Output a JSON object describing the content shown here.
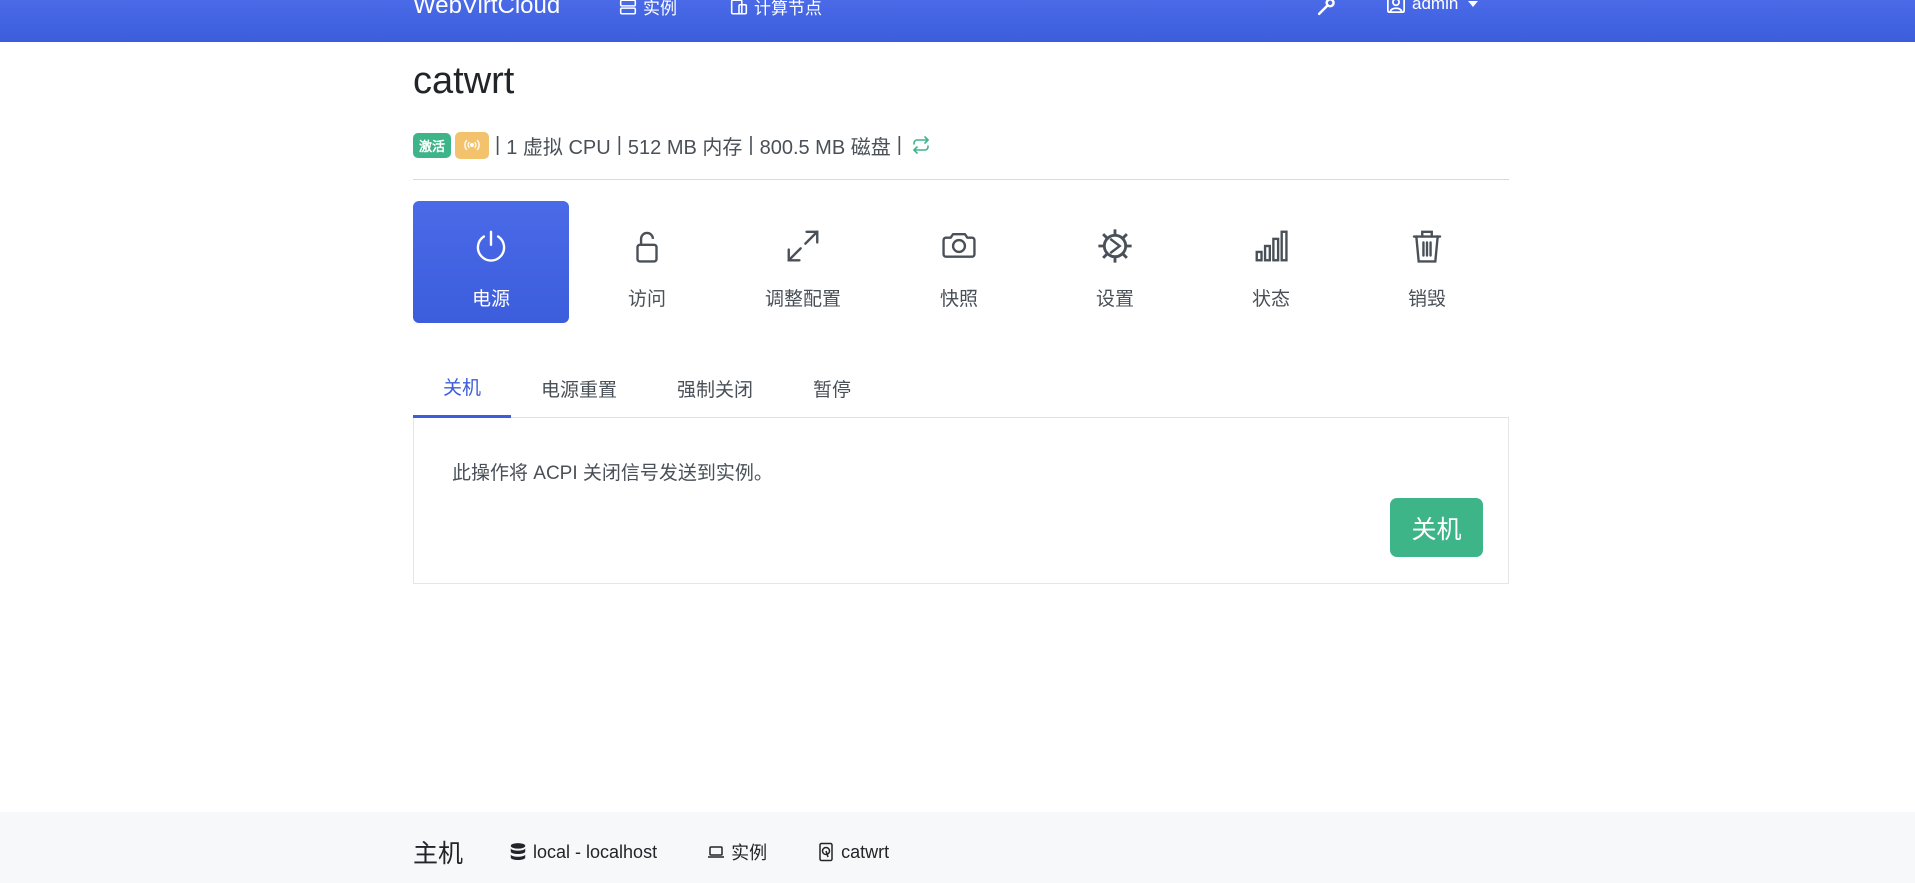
{
  "navbar": {
    "brand": "WebVirtCloud",
    "instances_label": "实例",
    "nodes_label": "计算节点",
    "user_label": "admin"
  },
  "instance": {
    "name": "catwrt",
    "status_badge": "激活",
    "vcpu": "1 虚拟 CPU",
    "memory": "512 MB 内存",
    "disk": "800.5 MB 磁盘"
  },
  "actions": [
    {
      "label": "电源",
      "icon": "power-icon",
      "active": true
    },
    {
      "label": "访问",
      "icon": "lock-icon",
      "active": false
    },
    {
      "label": "调整配置",
      "icon": "resize-icon",
      "active": false
    },
    {
      "label": "快照",
      "icon": "camera-icon",
      "active": false
    },
    {
      "label": "设置",
      "icon": "gear-icon",
      "active": false
    },
    {
      "label": "状态",
      "icon": "bar-chart-icon",
      "active": false
    },
    {
      "label": "销毁",
      "icon": "trash-icon",
      "active": false
    }
  ],
  "tabs": [
    {
      "label": "关机",
      "active": true
    },
    {
      "label": "电源重置",
      "active": false
    },
    {
      "label": "强制关闭",
      "active": false
    },
    {
      "label": "暂停",
      "active": false
    }
  ],
  "panel": {
    "description": "此操作将 ACPI 关闭信号发送到实例。",
    "button_label": "关机"
  },
  "footer": {
    "host_label": "主机",
    "crumbs": [
      {
        "label": "local - localhost",
        "icon": "database-icon"
      },
      {
        "label": "实例",
        "icon": "laptop-icon"
      },
      {
        "label": "catwrt",
        "icon": "instance-icon"
      }
    ]
  },
  "colors": {
    "primary": "#3c5ddc",
    "success": "#3eb489",
    "warning": "#f3c26c"
  }
}
